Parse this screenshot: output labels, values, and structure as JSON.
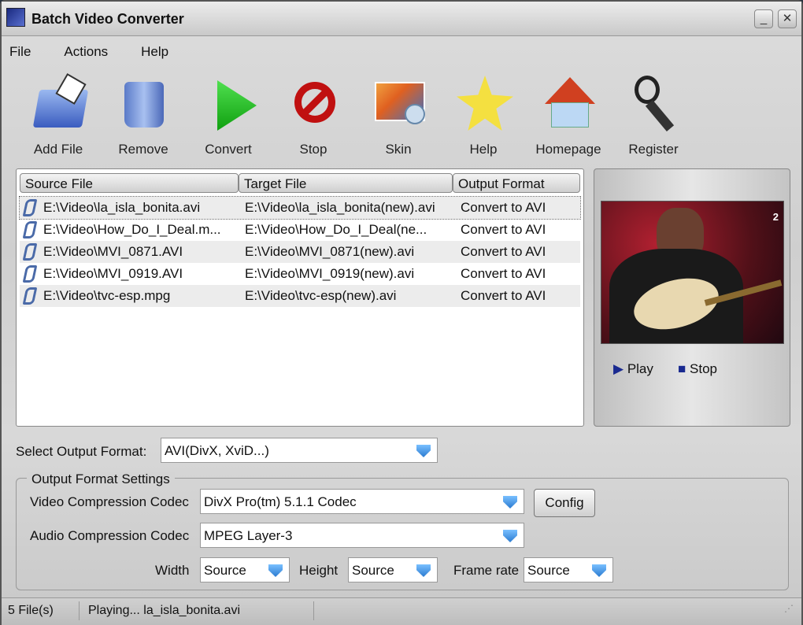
{
  "window": {
    "title": "Batch Video Converter"
  },
  "menu": [
    "File",
    "Actions",
    "Help"
  ],
  "toolbar": [
    {
      "label": "Add File",
      "icon": "folder-add-icon"
    },
    {
      "label": "Remove",
      "icon": "recycle-bin-icon"
    },
    {
      "label": "Convert",
      "icon": "play-icon"
    },
    {
      "label": "Stop",
      "icon": "stop-sign-icon"
    },
    {
      "label": "Skin",
      "icon": "skin-palette-icon"
    },
    {
      "label": "Help",
      "icon": "star-help-icon"
    },
    {
      "label": "Homepage",
      "icon": "house-icon"
    },
    {
      "label": "Register",
      "icon": "key-icon"
    }
  ],
  "list": {
    "columns": [
      "Source File",
      "Target File",
      "Output Format"
    ],
    "rows": [
      {
        "source": "E:\\Video\\la_isla_bonita.avi",
        "target": "E:\\Video\\la_isla_bonita(new).avi",
        "format": "Convert to AVI"
      },
      {
        "source": "E:\\Video\\How_Do_I_Deal.m...",
        "target": "E:\\Video\\How_Do_I_Deal(ne...",
        "format": "Convert to AVI"
      },
      {
        "source": "E:\\Video\\MVI_0871.AVI",
        "target": "E:\\Video\\MVI_0871(new).avi",
        "format": "Convert to AVI"
      },
      {
        "source": "E:\\Video\\MVI_0919.AVI",
        "target": "E:\\Video\\MVI_0919(new).avi",
        "format": "Convert to AVI"
      },
      {
        "source": "E:\\Video\\tvc-esp.mpg",
        "target": "E:\\Video\\tvc-esp(new).avi",
        "format": "Convert to AVI"
      }
    ]
  },
  "preview": {
    "overlay": "2",
    "play": "Play",
    "stop": "Stop"
  },
  "output": {
    "label": "Select Output Format:",
    "value": "AVI(DivX, XviD...)"
  },
  "settings": {
    "title": "Output Format Settings",
    "video_label": "Video Compression Codec",
    "video_value": "DivX Pro(tm) 5.1.1 Codec",
    "config": "Config",
    "audio_label": "Audio Compression Codec",
    "audio_value": "MPEG Layer-3",
    "width_label": "Width",
    "width_value": "Source",
    "height_label": "Height",
    "height_value": "Source",
    "framerate_label": "Frame rate",
    "framerate_value": "Source"
  },
  "status": {
    "count": "5 File(s)",
    "message": "Playing... la_isla_bonita.avi"
  }
}
